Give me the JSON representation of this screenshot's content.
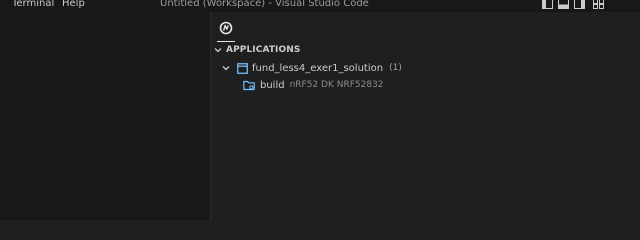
{
  "menu": {
    "items": [
      "Terminal",
      "Help"
    ]
  },
  "window": {
    "title": "Untitled (Workspace) - Visual Studio Code"
  },
  "layout_controls": [
    "toggle-primary-sidebar-icon",
    "toggle-panel-icon",
    "toggle-secondary-sidebar-icon",
    "customize-layout-icon"
  ],
  "panel": {
    "tab_icon": "nrf-connect-icon",
    "section_title": "APPLICATIONS",
    "applications": [
      {
        "name": "fund_less4_exer1_solution",
        "count": "(1)",
        "icon": "application-window-icon",
        "builds": [
          {
            "label": "build",
            "board": "nRF52 DK NRF52832",
            "icon": "build-folder-icon"
          }
        ]
      }
    ]
  },
  "colors": {
    "background": "#1f1f1f",
    "sidebar_background": "#181818",
    "accent_blue": "#75beff",
    "text": "#cccccc"
  }
}
